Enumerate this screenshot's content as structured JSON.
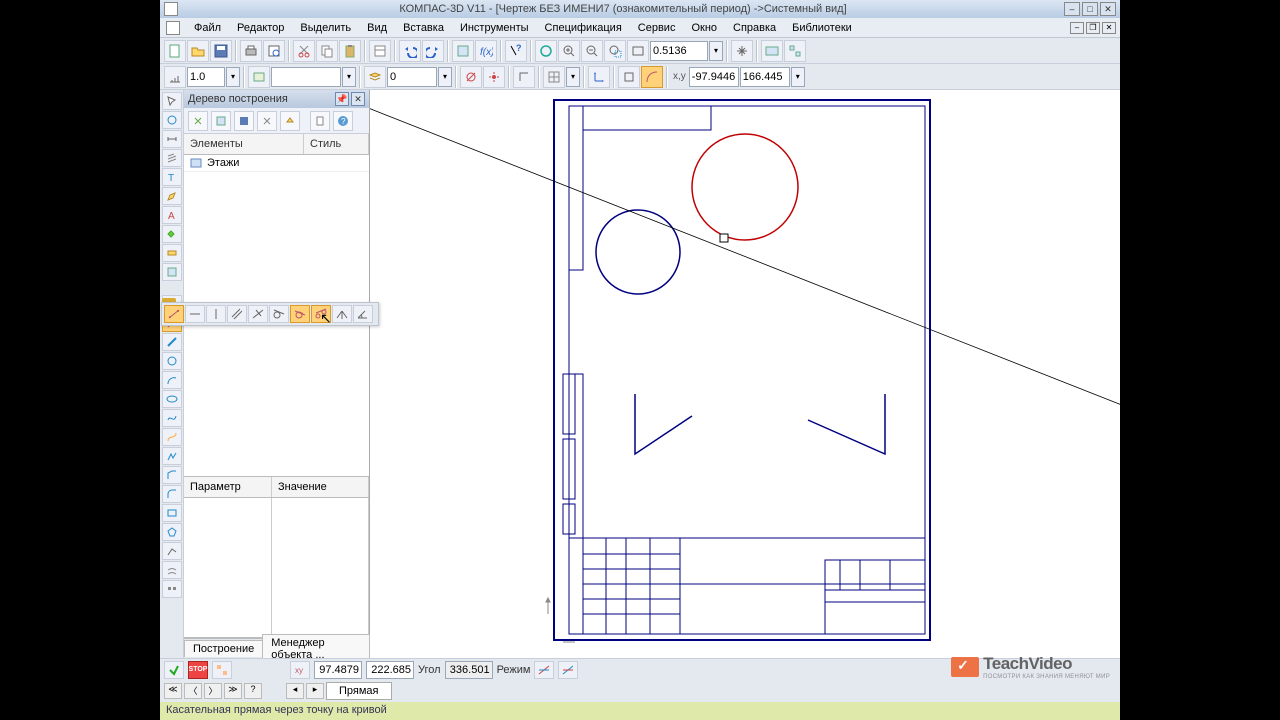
{
  "title": "КОМПАС-3D V11 - [Чертеж БЕЗ ИМЕНИ7 (ознакомительный период) ->Системный вид]",
  "menu": [
    "Файл",
    "Редактор",
    "Выделить",
    "Вид",
    "Вставка",
    "Инструменты",
    "Спецификация",
    "Сервис",
    "Окно",
    "Справка",
    "Библиотеки"
  ],
  "toolbar1": {
    "zoom_value": "0.5136"
  },
  "toolbar2": {
    "step": "1.0",
    "layer": "0",
    "coord_x": "-97.9446",
    "coord_y": "166.445"
  },
  "tree_panel": {
    "title": "Дерево построения",
    "cols": {
      "elements": "Элементы",
      "style": "Стиль"
    },
    "row1": "Этажи"
  },
  "prop_cols": {
    "param": "Параметр",
    "value": "Значение"
  },
  "side_tabs": {
    "build": "Построение",
    "manager": "Менеджер объекта ..."
  },
  "coord_bar": {
    "x": "97.4879",
    "y": "222.685",
    "angle_label": "Угол",
    "angle": "336.501",
    "mode_label": "Режим"
  },
  "doc_tab": "Прямая",
  "status": "Касательная прямая через точку на кривой",
  "watermark": {
    "brand": "TeachVideo",
    "tagline": "ПОСМОТРИ КАК ЗНАНИЯ МЕНЯЮТ МИР"
  },
  "nav_symbols": {
    "first": "≪",
    "prev": "〈",
    "next": "〉",
    "last": "≫"
  },
  "icons": {
    "pin": "📌",
    "close": "✕",
    "help": "?",
    "stop": "■"
  }
}
